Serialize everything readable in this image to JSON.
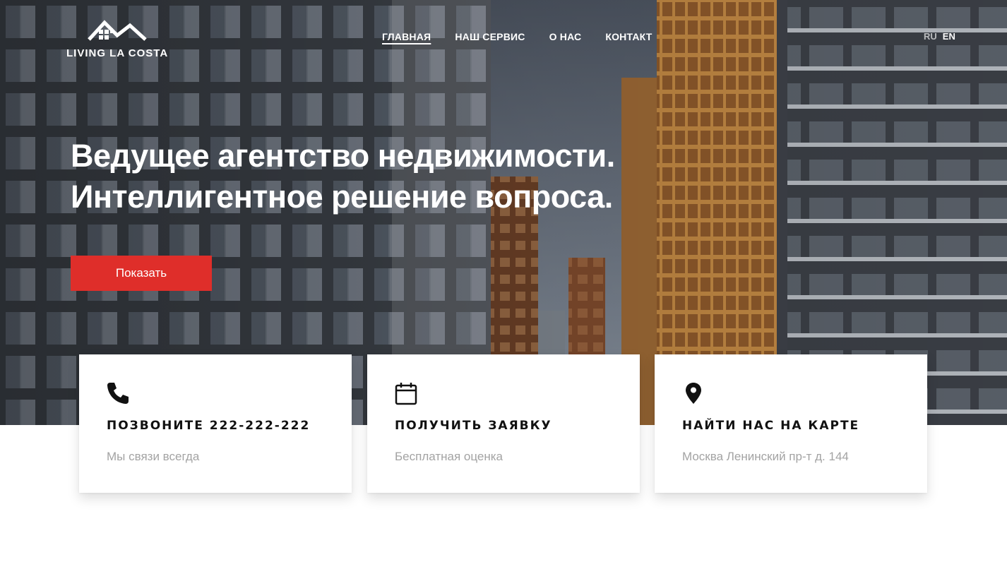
{
  "header": {
    "logo_text": "LIVING LA COSTA",
    "nav": [
      {
        "label": "ГЛАВНАЯ",
        "active": true
      },
      {
        "label": "НАШ СЕРВИС",
        "active": false
      },
      {
        "label": "О НАС",
        "active": false
      },
      {
        "label": "КОНТАКТ",
        "active": false
      }
    ],
    "languages": [
      "RU",
      "EN"
    ]
  },
  "hero": {
    "headline_line1": "Ведущее агентство недвижимости.",
    "headline_line2": "Интеллигентное решение вопроса.",
    "cta_label": "Показать"
  },
  "cards": [
    {
      "icon": "phone-icon",
      "title": "ПОЗВОНИТЕ 222-222-222",
      "subtitle": "Мы связи всегда"
    },
    {
      "icon": "calendar-icon",
      "title": "ПОЛУЧИТЬ ЗАЯВКУ",
      "subtitle": "Бесплатная оценка"
    },
    {
      "icon": "map-pin-icon",
      "title": "НАЙТИ НАС НА КАРТЕ",
      "subtitle": "Москва Ленинский пр-т д. 144"
    }
  ],
  "colors": {
    "accent": "#df2e2a",
    "card_title": "#111111",
    "card_subtitle": "#a3a3a3"
  }
}
